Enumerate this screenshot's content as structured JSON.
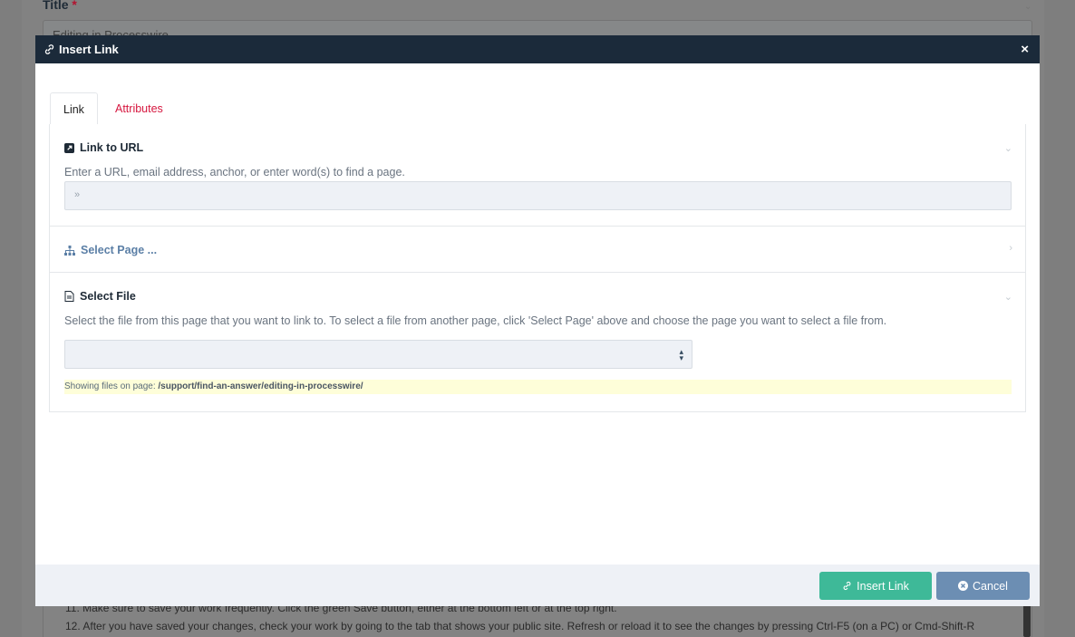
{
  "background": {
    "title_label": "Title",
    "required_mark": "*",
    "title_value": "Editing in Processwire",
    "body_lines": [
      "11. Make sure to save your work frequently. Click the green Save button, either at the bottom left or at the top right.",
      "12. After you have saved your changes, check your work by going to the tab that shows your public site. Refresh or reload it to see the changes by pressing Ctrl-F5 (on a PC) or Cmd-Shift-R"
    ]
  },
  "modal": {
    "title": "Insert Link",
    "close_glyph": "×",
    "tabs": [
      {
        "label": "Link",
        "active": true
      },
      {
        "label": "Attributes",
        "active": false
      }
    ],
    "link_to_url": {
      "heading": "Link to URL",
      "description": "Enter a URL, email address, anchor, or enter word(s) to find a page.",
      "prefix": "»",
      "value": ""
    },
    "select_page": {
      "heading": "Select Page ..."
    },
    "select_file": {
      "heading": "Select File",
      "description": "Select the file from this page that you want to link to. To select a file from another page, click 'Select Page' above and choose the page you want to select a file from.",
      "selected": "",
      "note_prefix": "Showing files on page:",
      "note_path": "/support/find-an-answer/editing-in-processwire/"
    },
    "buttons": {
      "insert_label": "Insert Link",
      "cancel_label": "Cancel"
    }
  },
  "colors": {
    "header_bg": "#1b2a3a",
    "accent_red": "#d6173f",
    "insert_green": "#3eb998",
    "cancel_blue": "#6c8eb3",
    "note_bg": "#fefed9"
  }
}
